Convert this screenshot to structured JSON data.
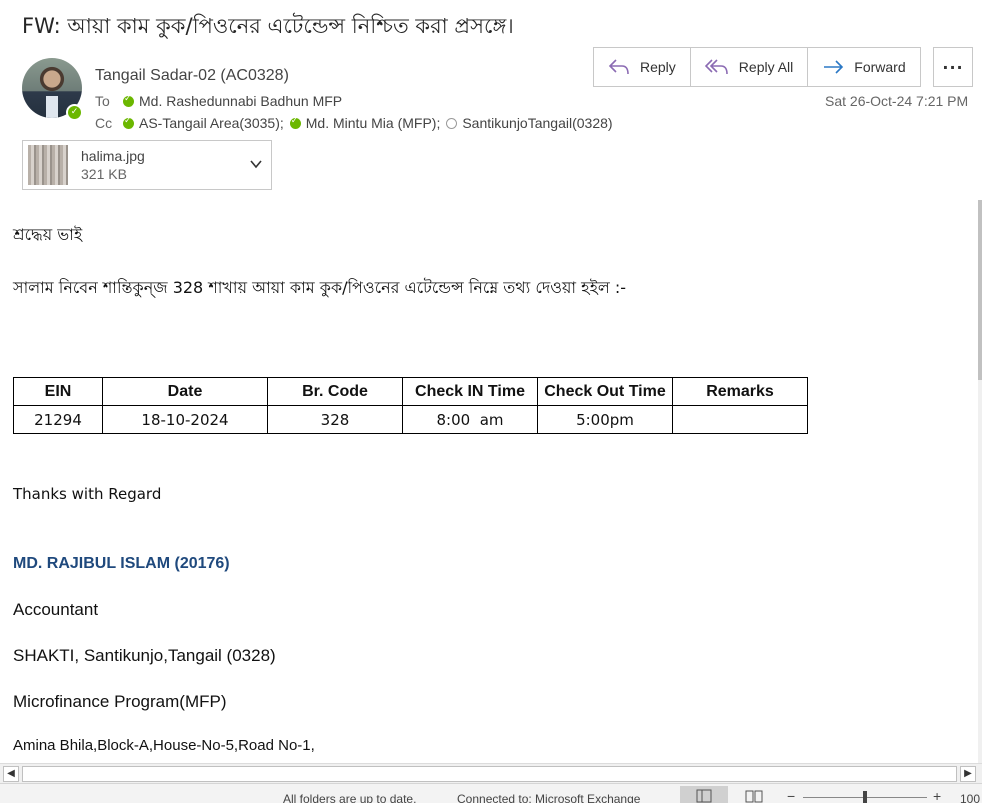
{
  "message": {
    "subject": "FW: আয়া কাম কুক/পিওনের এটেন্ডেন্স নিশ্চিত করা প্রসঙ্গে।",
    "sender": "Tangail Sadar-02 (AC0328)",
    "to_label": "To",
    "cc_label": "Cc",
    "to": [
      {
        "name": "Md. Rashedunnabi Badhun MFP",
        "status": "online"
      }
    ],
    "cc": [
      {
        "name": "AS-Tangail Area(3035);",
        "status": "online"
      },
      {
        "name": "Md. Mintu Mia (MFP);",
        "status": "online"
      },
      {
        "name": "SantikunjoTangail(0328)",
        "status": "offline"
      }
    ],
    "datetime": "Sat 26-Oct-24 7:21 PM"
  },
  "actions": {
    "reply": "Reply",
    "reply_all": "Reply All",
    "forward": "Forward",
    "more": "···"
  },
  "attachment": {
    "name": "halima.jpg",
    "size": "321 KB"
  },
  "body": {
    "greeting": "শ্রদ্ধেয় ভাই",
    "intro": "সালাম নিবেন শান্তিকুন্জ 328 শাখায় আয়া কাম কুক/পিওনের এটেন্ডেন্স নিম্নে তথ্য দেওয়া হইল :-",
    "table": {
      "headers": [
        "EIN",
        "Date",
        "Br. Code",
        "Check IN Time",
        "Check Out Time",
        "Remarks"
      ],
      "rows": [
        [
          "21294",
          "18-10-2024",
          "328",
          "8:00  am",
          "5:00pm",
          ""
        ]
      ]
    },
    "thanks": "Thanks with Regard",
    "signature": {
      "name": "MD. RAJIBUL ISLAM (20176)",
      "title": "Accountant",
      "office": "SHAKTI, Santikunjo,Tangail (0328)",
      "program": "Microfinance Program(MFP)",
      "address": "Amina Bhila,Block-A,House-No-5,Road No-1,"
    }
  },
  "status_bar": {
    "sync": "All folders are up to date.",
    "connection": "Connected to: Microsoft Exchange",
    "zoom": "100"
  },
  "colors": {
    "presence": "#6bb700",
    "signature_name": "#1f497d",
    "accent_icon": "#8b6bb3"
  }
}
